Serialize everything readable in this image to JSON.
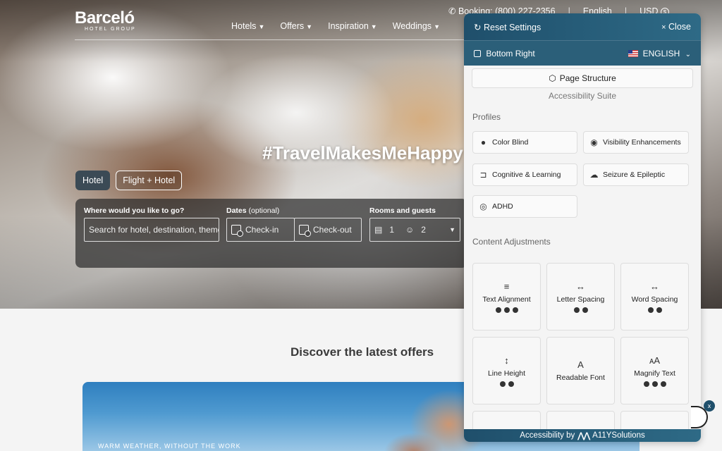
{
  "topbar": {
    "booking": "Booking: (800) 227-2356",
    "sep1": "|",
    "language": "English",
    "sep2": "|",
    "currency": "USD"
  },
  "brand": {
    "name": "Barceló",
    "sub": "HOTEL GROUP"
  },
  "nav": [
    "Hotels",
    "Offers",
    "Inspiration",
    "Weddings"
  ],
  "hero": {
    "hashtag": "#TravelMakesMeHappy"
  },
  "booking_form": {
    "tabs": [
      "Hotel",
      "Flight + Hotel"
    ],
    "where_label": "Where would you like to go?",
    "where_placeholder": "Search for hotel, destination, theme",
    "dates_label": "Dates",
    "dates_optional": "(optional)",
    "checkin": "Check-in",
    "checkout": "Check-out",
    "rooms_label": "Rooms and guests",
    "rooms": "1",
    "guests": "2"
  },
  "offers": {
    "title": "Discover the latest offers",
    "caption": "WARM WEATHER, WITHOUT THE WORK"
  },
  "a11y": {
    "reset": "Reset Settings",
    "close": "Close",
    "position": "Bottom Right",
    "language": "ENGLISH",
    "page_structure": "Page Structure",
    "suite": "Accessibility Suite",
    "profiles_title": "Profiles",
    "profiles": [
      "Color Blind",
      "Visibility Enhancements",
      "Cognitive & Learning",
      "Seizure & Epileptic",
      "ADHD"
    ],
    "content_title": "Content Adjustments",
    "adjustments": [
      "Text Alignment",
      "Letter Spacing",
      "Word Spacing",
      "Line Height",
      "Readable Font",
      "Magnify Text"
    ],
    "footer_by": "Accessibility by",
    "footer_brand": "A11YSolutions"
  },
  "icons": {
    "phone": "phone-icon",
    "currency": "dollar-icon",
    "caret": "caret-down-icon",
    "reset": "refresh-icon",
    "close": "close-icon",
    "position": "position-icon",
    "structure": "cube-icon",
    "calendar": "calendar-icon",
    "bed": "bed-icon",
    "people": "people-icon"
  },
  "colors": {
    "panel_header": "#1f4f6b",
    "active_tab": "#3b4a55"
  }
}
